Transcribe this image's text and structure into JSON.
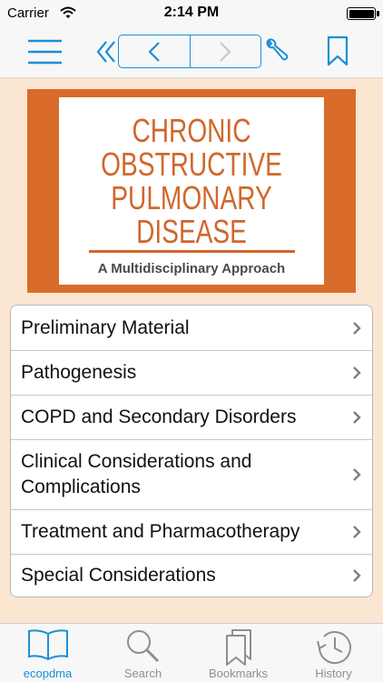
{
  "status_bar": {
    "carrier": "Carrier",
    "time": "2:14 PM",
    "battery_level": 1.0
  },
  "nav_bar": {
    "icons": [
      "menu-icon",
      "double-chevron-left-icon",
      "back-icon",
      "forward-icon",
      "wrench-icon",
      "bookmark-icon"
    ],
    "accent_color": "#1b8fd6"
  },
  "cover": {
    "title": "CHRONIC\nOBSTRUCTIVE\nPULMONARY\nDISEASE",
    "subtitle": "A Multidisciplinary Approach",
    "border_color": "#d96b2b"
  },
  "toc": {
    "items": [
      {
        "label": "Preliminary Material"
      },
      {
        "label": "Pathogenesis"
      },
      {
        "label": "COPD and Secondary Disorders"
      },
      {
        "label": "Clinical Considerations and Complications"
      },
      {
        "label": "Treatment and Pharmacotherapy"
      },
      {
        "label": "Special Considerations"
      }
    ]
  },
  "tab_bar": {
    "active": "ecopdma",
    "tabs": [
      {
        "label": "ecopdma",
        "icon": "book-icon"
      },
      {
        "label": "Search",
        "icon": "search-icon"
      },
      {
        "label": "Bookmarks",
        "icon": "bookmarks-icon"
      },
      {
        "label": "History",
        "icon": "history-icon"
      }
    ]
  }
}
